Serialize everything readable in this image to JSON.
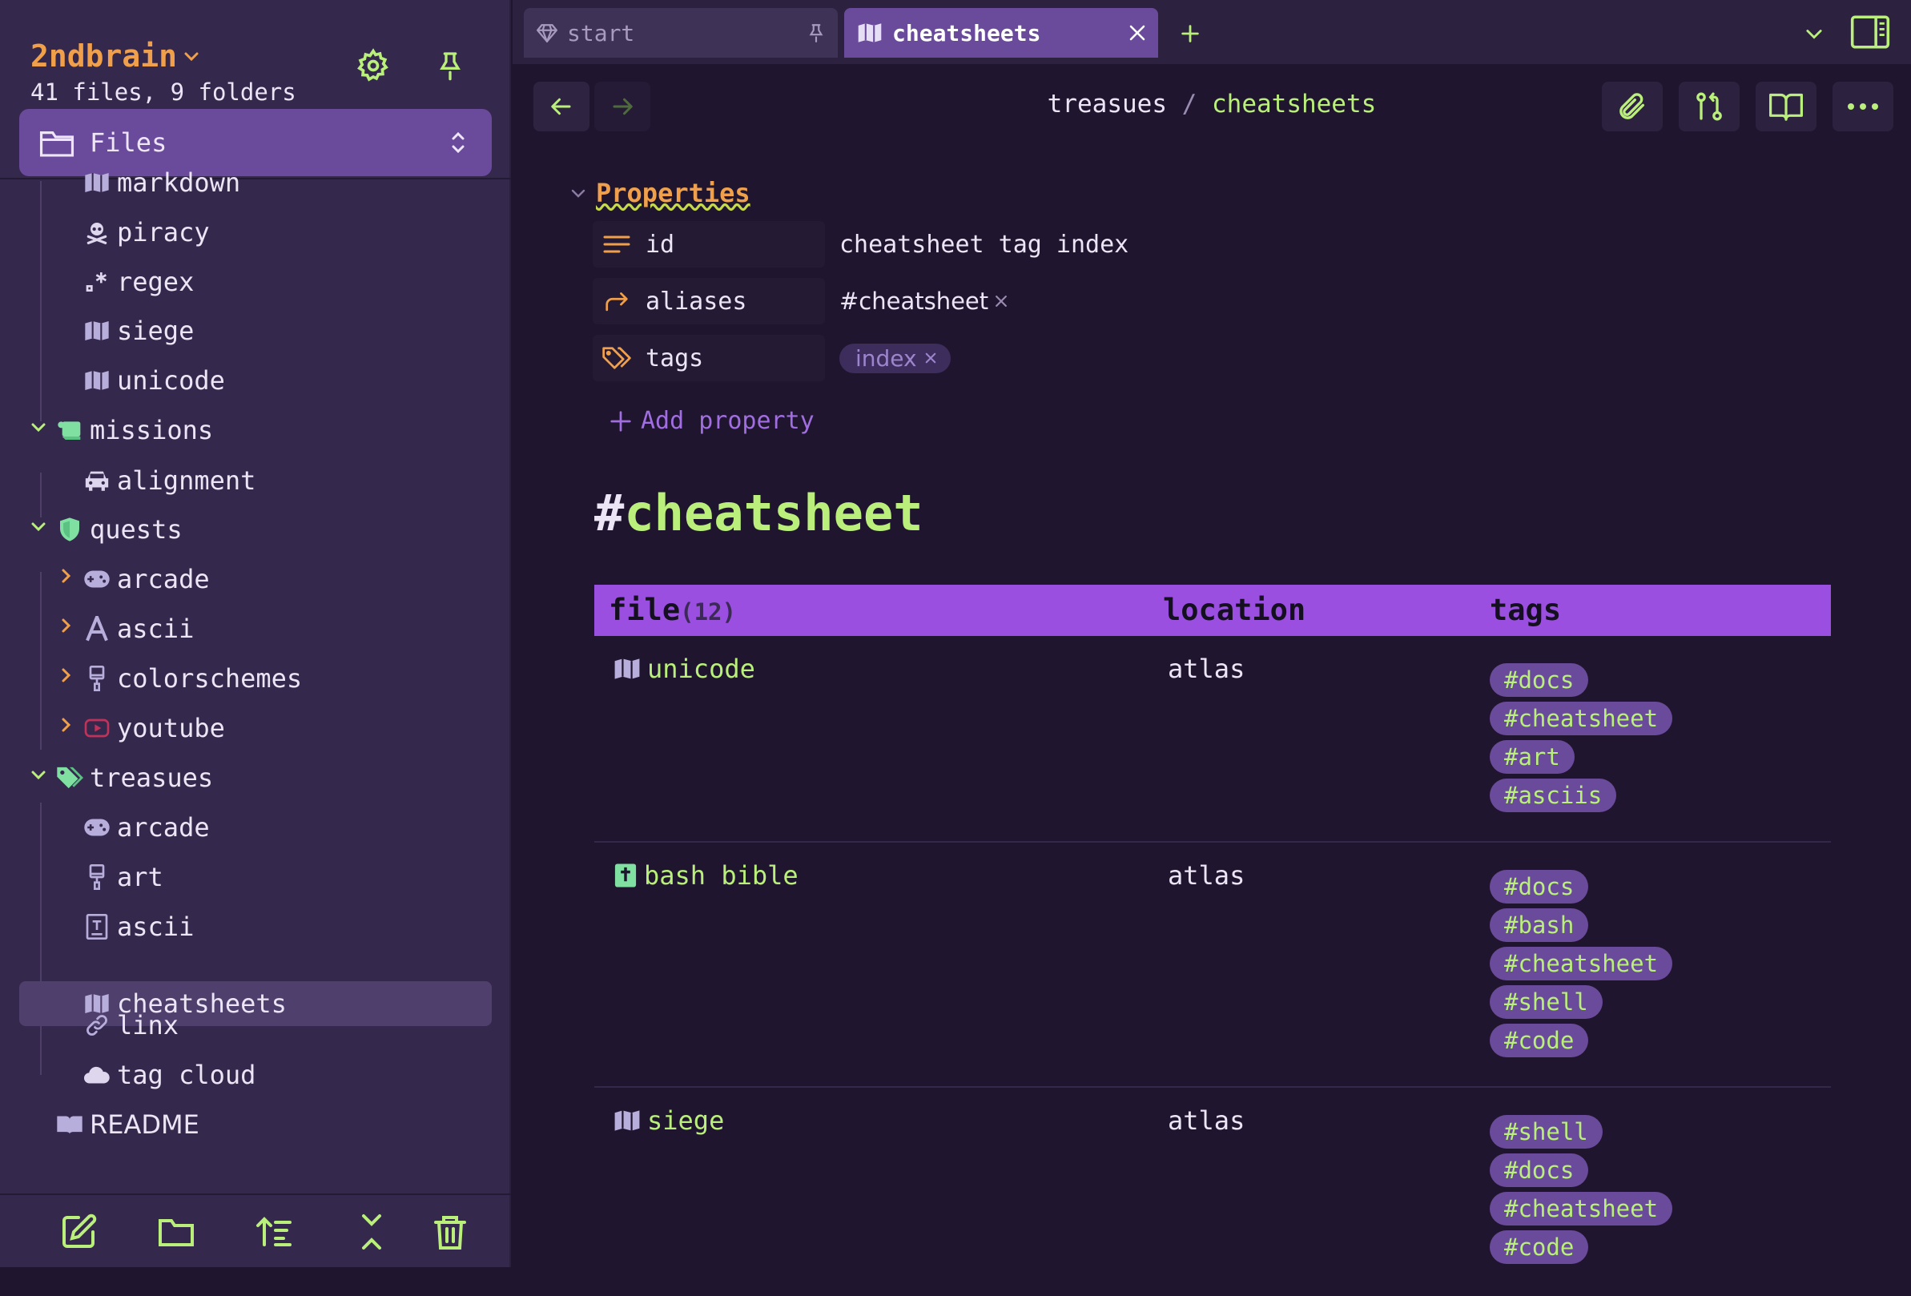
{
  "colors": {
    "accent_orange": "#f0a04b",
    "accent_green": "#b9ef7a",
    "accent_purple": "#9a4fe0",
    "sidebar_bg": "#35284d",
    "main_bg": "#20152f"
  },
  "sidebar": {
    "vault_name": "2ndbrain",
    "vault_stats": "41 files, 9 folders",
    "view_selector": "Files",
    "tree": [
      {
        "label": "markdown",
        "icon": "map-icon"
      },
      {
        "label": "piracy",
        "icon": "skull-crossbones-icon"
      },
      {
        "label": "regex",
        "icon": "regex-icon"
      },
      {
        "label": "siege",
        "icon": "map-icon"
      },
      {
        "label": "unicode",
        "icon": "map-icon"
      },
      {
        "label": "missions",
        "icon": "scroll-icon",
        "folder": true,
        "expanded": true
      },
      {
        "label": "alignment",
        "icon": "car-icon"
      },
      {
        "label": "quests",
        "icon": "shield-icon",
        "folder": true,
        "expanded": true
      },
      {
        "label": "arcade",
        "icon": "gamepad-icon",
        "folder": true,
        "expanded": false
      },
      {
        "label": "ascii",
        "icon": "letter-a-icon",
        "folder": true,
        "expanded": false
      },
      {
        "label": "colorschemes",
        "icon": "paintbrush-icon",
        "folder": true,
        "expanded": false
      },
      {
        "label": "youtube",
        "icon": "youtube-icon",
        "folder": true,
        "expanded": false
      },
      {
        "label": "treasues",
        "icon": "tags-icon",
        "folder": true,
        "expanded": true
      },
      {
        "label": "arcade",
        "icon": "gamepad-icon"
      },
      {
        "label": "art",
        "icon": "paintbrush-icon"
      },
      {
        "label": "ascii",
        "icon": "text-frame-icon"
      },
      {
        "label": "cheatsheets",
        "icon": "map-icon",
        "active": true
      },
      {
        "label": "linx",
        "icon": "link-icon"
      },
      {
        "label": "tag cloud",
        "icon": "cloud-icon"
      },
      {
        "label": "README",
        "icon": "book-icon"
      }
    ]
  },
  "tabs": [
    {
      "label": "start",
      "icon": "gem-icon",
      "pinned": true
    },
    {
      "label": "cheatsheets",
      "icon": "map-icon",
      "active": true
    }
  ],
  "breadcrumb": {
    "parent": "treasues",
    "separator": "/",
    "current": "cheatsheets"
  },
  "properties": {
    "title": "Properties",
    "rows": [
      {
        "key": "id",
        "value": "cheatsheet tag index"
      },
      {
        "key": "aliases",
        "value": "#cheatsheet"
      },
      {
        "key": "tags",
        "value": "index"
      }
    ],
    "add_label": "Add property"
  },
  "heading": {
    "hash": "#",
    "text": "cheatsheet"
  },
  "table": {
    "headers": {
      "file": "file",
      "count": "(12)",
      "location": "location",
      "tags": "tags"
    },
    "rows": [
      {
        "file": "unicode",
        "icon": "map-icon",
        "location": "atlas",
        "tags": [
          "#docs",
          "#cheatsheet",
          "#art",
          "#asciis"
        ]
      },
      {
        "file": "bash bible",
        "icon": "bible-icon",
        "location": "atlas",
        "tags": [
          "#docs",
          "#bash",
          "#cheatsheet",
          "#shell",
          "#code"
        ]
      },
      {
        "file": "siege",
        "icon": "map-icon",
        "location": "atlas",
        "tags": [
          "#shell",
          "#docs",
          "#cheatsheet",
          "#code"
        ]
      }
    ]
  }
}
